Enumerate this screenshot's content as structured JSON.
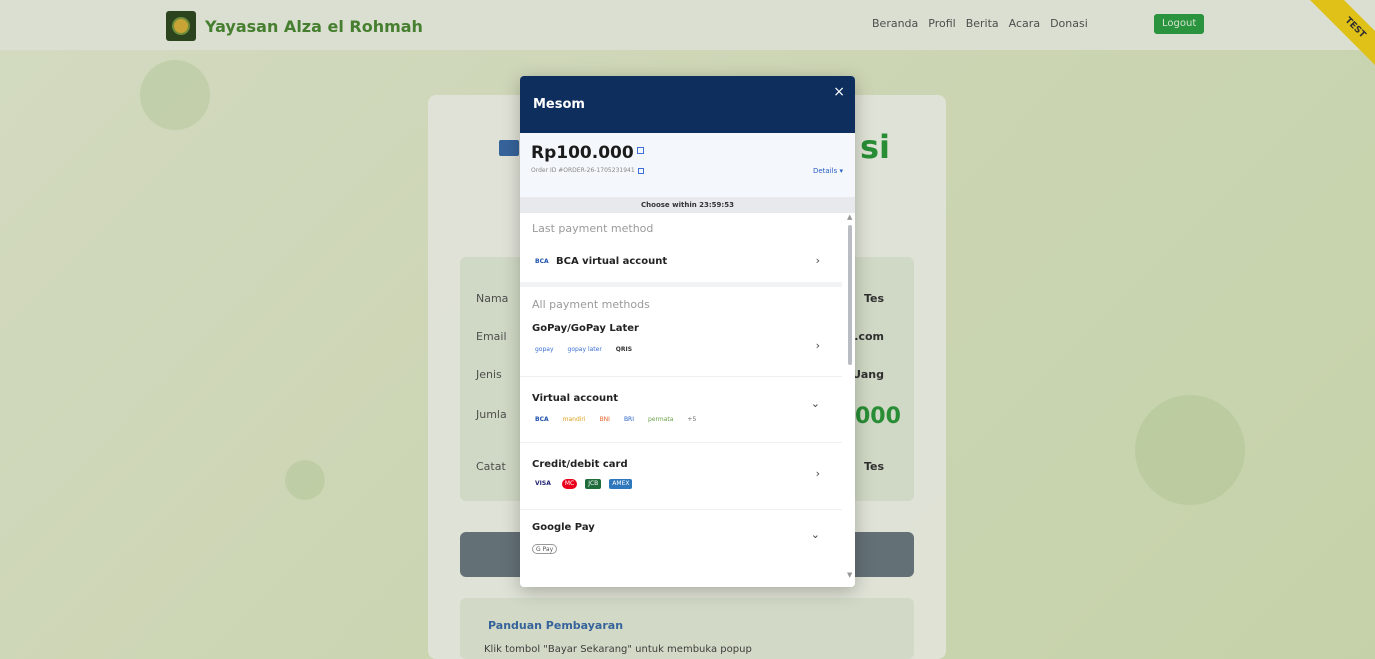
{
  "navbar": {
    "brand": "Yayasan Alza el Rohmah",
    "links": [
      "Beranda",
      "Profil",
      "Berita",
      "Acara",
      "Donasi"
    ],
    "logout": "Logout",
    "ribbon": "TEST"
  },
  "background_page": {
    "title_partial": "si",
    "rows": [
      {
        "label": "Nama",
        "value": "Tes"
      },
      {
        "label": "Email",
        "value": "il.com"
      },
      {
        "label": "Jenis",
        "value": "Uang"
      },
      {
        "label": "Jumla",
        "value": "000"
      },
      {
        "label": "Catat",
        "value": "Tes"
      }
    ],
    "guide_title": "Panduan Pembayaran",
    "guide_item": "Klik tombol \"Bayar Sekarang\" untuk membuka popup"
  },
  "modal": {
    "title": "Mesom",
    "close_label": "×",
    "amount": "Rp100.000",
    "order_id": "Order ID #ORDER-26-1705231941",
    "details_label": "Details ▾",
    "timer_text": "Choose within 23:59:53",
    "last_label": "Last payment method",
    "last_method": "BCA virtual account",
    "all_label": "All payment methods",
    "methods": [
      {
        "name": "GoPay/GoPay Later",
        "chevron": "›",
        "logos": [
          "gopay",
          "gopay later",
          "QRIS"
        ]
      },
      {
        "name": "Virtual account",
        "chevron": "⌄",
        "logos": [
          "BCA",
          "mandiri",
          "BNI",
          "BRI",
          "permata",
          "+5"
        ]
      },
      {
        "name": "Credit/debit card",
        "chevron": "›",
        "logos": [
          "VISA",
          "MC",
          "JCB",
          "AMEX"
        ]
      },
      {
        "name": "Google Pay",
        "chevron": "⌄",
        "logos": [
          "G Pay"
        ]
      }
    ],
    "colors": {
      "header": "#0e2e5e",
      "link": "#2a5fc7"
    }
  }
}
